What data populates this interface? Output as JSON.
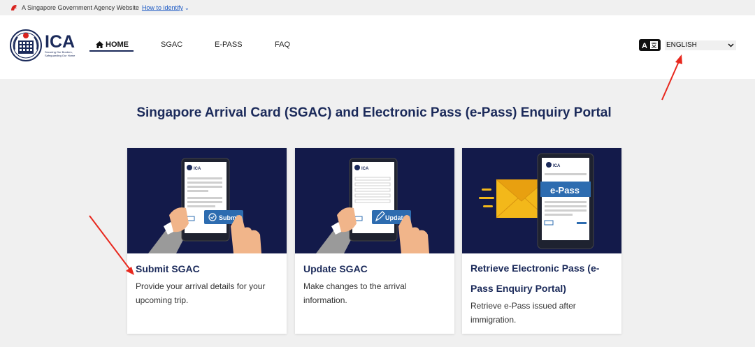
{
  "masthead": {
    "text": "A Singapore Government Agency Website",
    "link": "How to identify"
  },
  "logo": {
    "name": "ICA",
    "tagline_1": "Securing Our Borders,",
    "tagline_2": "Safeguarding Our Home"
  },
  "nav": {
    "home": "HOME",
    "sgac": "SGAC",
    "epass": "E-PASS",
    "faq": "FAQ"
  },
  "language": {
    "icon_label": "A文",
    "selected": "ENGLISH"
  },
  "page_title": "Singapore Arrival Card (SGAC) and Electronic Pass (e-Pass) Enquiry Portal",
  "cards": [
    {
      "title": "Submit SGAC",
      "description": "Provide your arrival details for your upcoming trip.",
      "image_button": "Submit",
      "image_logo": "ICA"
    },
    {
      "title": "Update SGAC",
      "description": "Make changes to the arrival information.",
      "image_button": "Update",
      "image_logo": "ICA"
    },
    {
      "title": "Retrieve Electronic Pass (e-Pass Enquiry Portal)",
      "description": "Retrieve e-Pass issued after immigration.",
      "image_banner": "e-Pass",
      "image_logo": "ICA"
    }
  ],
  "colors": {
    "brand_navy": "#1b2a5a",
    "card_image_bg": "#131a4a",
    "annotation_red": "#e8281e",
    "accent_blue": "#2d6cb0"
  }
}
